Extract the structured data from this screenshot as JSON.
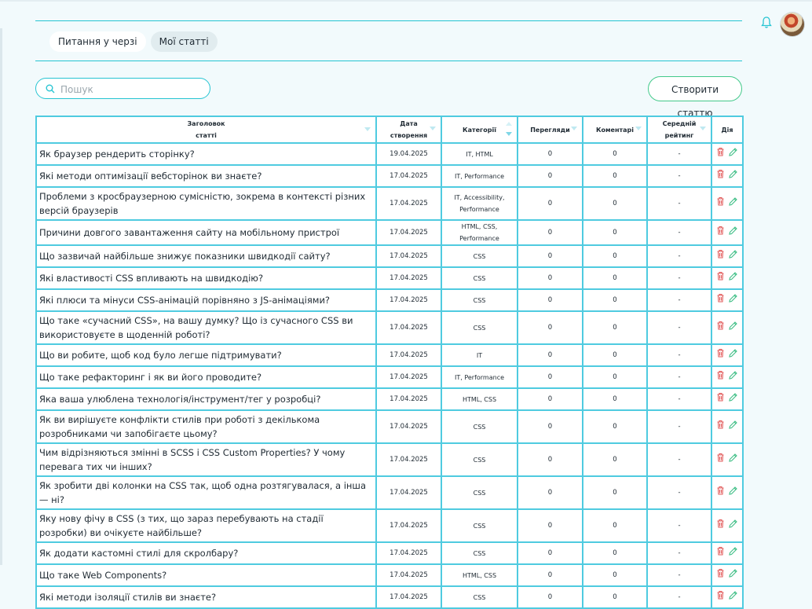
{
  "tabs": [
    {
      "label": "Питання у черзі",
      "active": true
    },
    {
      "label": "Мої статті",
      "active": false
    }
  ],
  "search": {
    "placeholder": "Пошук",
    "value": ""
  },
  "create_button": "Створити статтю",
  "table": {
    "headers": [
      "Заголовок статті",
      "Дата створення",
      "Категорії",
      "Перегляди",
      "Коментарі",
      "Середній рейтинг",
      "Дія"
    ],
    "rows": [
      {
        "title": "Як браузер рендерить сторінку?",
        "date": "19.04.2025",
        "categories": "IT, HTML",
        "views": "0",
        "comments": "0",
        "rating": "-"
      },
      {
        "title": "Які методи оптимізації вебсторінок ви знаєте?",
        "date": "17.04.2025",
        "categories": "IT, Performance",
        "views": "0",
        "comments": "0",
        "rating": "-"
      },
      {
        "title": "Проблеми з кросбраузерною сумісністю, зокрема в контексті різних версій браузерів",
        "date": "17.04.2025",
        "categories": "IT, Accessibility, Performance",
        "views": "0",
        "comments": "0",
        "rating": "-"
      },
      {
        "title": "Причини довгого завантаження сайту на мобільному пристрої",
        "date": "17.04.2025",
        "categories": "HTML, CSS, Performance",
        "views": "0",
        "comments": "0",
        "rating": "-"
      },
      {
        "title": "Що зазвичай найбільше знижує показники швидкодії сайту?",
        "date": "17.04.2025",
        "categories": "CSS",
        "views": "0",
        "comments": "0",
        "rating": "-"
      },
      {
        "title": "Які властивості CSS впливають на швидкодію?",
        "date": "17.04.2025",
        "categories": "CSS",
        "views": "0",
        "comments": "0",
        "rating": "-"
      },
      {
        "title": "Які плюси та мінуси CSS-анімацій порівняно з JS-анімаціями?",
        "date": "17.04.2025",
        "categories": "CSS",
        "views": "0",
        "comments": "0",
        "rating": "-"
      },
      {
        "title": "Що таке «сучасний CSS», на вашу думку? Що із сучасного CSS ви використовуєте в щоденній роботі?",
        "date": "17.04.2025",
        "categories": "CSS",
        "views": "0",
        "comments": "0",
        "rating": "-"
      },
      {
        "title": "Що ви робите, щоб код було легше підтримувати?",
        "date": "17.04.2025",
        "categories": "IT",
        "views": "0",
        "comments": "0",
        "rating": "-"
      },
      {
        "title": "Що таке рефакторинг і як ви його проводите?",
        "date": "17.04.2025",
        "categories": "IT, Performance",
        "views": "0",
        "comments": "0",
        "rating": "-"
      },
      {
        "title": "Яка ваша улюблена технологія/інструмент/тег у розробці?",
        "date": "17.04.2025",
        "categories": "HTML, CSS",
        "views": "0",
        "comments": "0",
        "rating": "-"
      },
      {
        "title": "Як ви вирішуєте конфлікти стилів при роботі з декількома розробниками чи запобігаєте цьому?",
        "date": "17.04.2025",
        "categories": "CSS",
        "views": "0",
        "comments": "0",
        "rating": "-"
      },
      {
        "title": "Чим відрізняються змінні в SCSS і CSS Custom Properties? У чому перевага тих чи інших?",
        "date": "17.04.2025",
        "categories": "CSS",
        "views": "0",
        "comments": "0",
        "rating": "-"
      },
      {
        "title": "Як зробити дві колонки на CSS так, щоб одна розтягувалася, а інша — ні?",
        "date": "17.04.2025",
        "categories": "CSS",
        "views": "0",
        "comments": "0",
        "rating": "-"
      },
      {
        "title": "Яку нову фічу в CSS (з тих, що зараз перебувають на стадії розробки) ви очікуєте найбільше?",
        "date": "17.04.2025",
        "categories": "CSS",
        "views": "0",
        "comments": "0",
        "rating": "-"
      },
      {
        "title": "Як додати кастомні стилі для скролбару?",
        "date": "17.04.2025",
        "categories": "CSS",
        "views": "0",
        "comments": "0",
        "rating": "-"
      },
      {
        "title": "Що таке Web Components?",
        "date": "17.04.2025",
        "categories": "HTML, CSS",
        "views": "0",
        "comments": "0",
        "rating": "-"
      },
      {
        "title": "Які методи ізоляції стилів ви знаєте?",
        "date": "17.04.2025",
        "categories": "CSS",
        "views": "0",
        "comments": "0",
        "rating": "-"
      }
    ]
  },
  "icons": {
    "bell": "bell-icon",
    "search": "search-icon",
    "delete": "trash-icon",
    "edit": "pencil-icon"
  },
  "colors": {
    "accent": "#27c4d2",
    "table_border": "#4fcbe0",
    "create_button_border": "#43c98a",
    "delete_icon": "#e25b5b",
    "edit_icon": "#3fbf86",
    "background": "#f2fafc"
  }
}
